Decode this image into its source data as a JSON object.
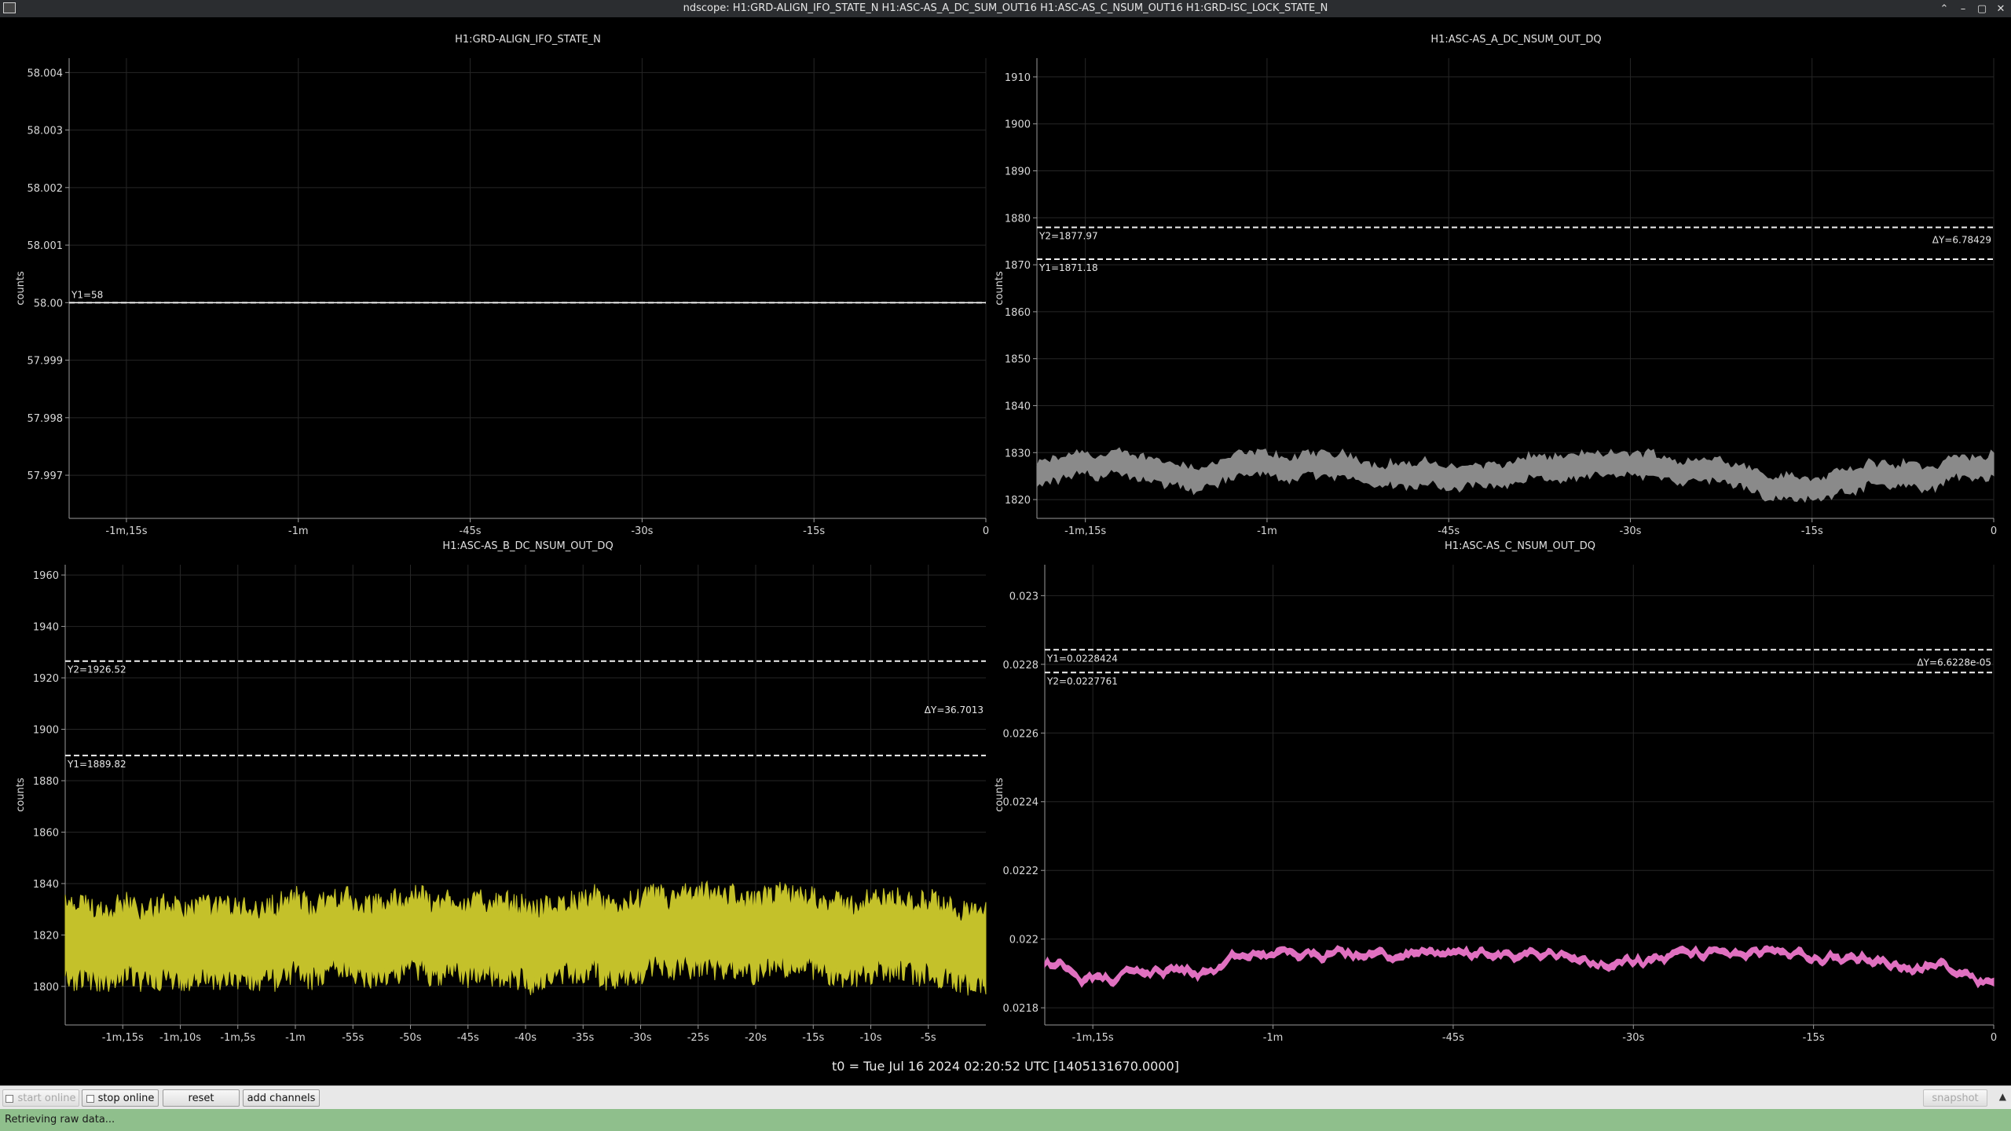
{
  "window": {
    "title": "ndscope: H1:GRD-ALIGN_IFO_STATE_N H1:ASC-AS_A_DC_SUM_OUT16 H1:ASC-AS_C_NSUM_OUT16 H1:GRD-ISC_LOCK_STATE_N",
    "buttons": [
      "⌃",
      "–",
      "▢",
      "✕"
    ]
  },
  "plots": [
    {
      "title": "H1:GRD-ALIGN_IFO_STATE_N",
      "ylabel": "counts",
      "yticks": [
        "58.004",
        "58.003",
        "58.002",
        "58.001",
        "58.00",
        "57.999",
        "57.998",
        "57.997"
      ],
      "ytick_values": [
        58.004,
        58.003,
        58.002,
        58.001,
        58.0,
        57.999,
        57.998,
        57.997
      ],
      "ylim": [
        57.99625,
        58.00425
      ],
      "xticks": [
        "-1m,15s",
        "-1m",
        "-45s",
        "-30s",
        "-15s",
        "0"
      ],
      "xtick_values": [
        -75,
        -60,
        -45,
        -30,
        -15,
        0
      ],
      "xlim": [
        -80,
        0
      ],
      "trace_color": "#ffffff",
      "trace_style": "flat",
      "trace_center": 58.0,
      "cursors": [
        {
          "label": "Y1=58",
          "value": 58.0
        }
      ],
      "delta": ""
    },
    {
      "title": "H1:ASC-AS_A_DC_NSUM_OUT_DQ",
      "ylabel": "counts",
      "yticks": [
        "1910",
        "1900",
        "1890",
        "1880",
        "1870",
        "1860",
        "1850",
        "1840",
        "1830",
        "1820"
      ],
      "ytick_values": [
        1910,
        1900,
        1890,
        1880,
        1870,
        1860,
        1850,
        1840,
        1830,
        1820
      ],
      "ylim": [
        1816,
        1914
      ],
      "xticks": [
        "-1m,15s",
        "-1m",
        "-45s",
        "-30s",
        "-15s",
        "0"
      ],
      "xtick_values": [
        -75,
        -60,
        -45,
        -30,
        -15,
        0
      ],
      "xlim": [
        -79,
        0
      ],
      "trace_color": "#8a8a8a",
      "trace_style": "band",
      "trace_center": 1825,
      "trace_halfwidth": 2.5,
      "trace_wander": 3,
      "cursors": [
        {
          "label": "Y2=1877.97",
          "value": 1877.97
        },
        {
          "label": "Y1=1871.18",
          "value": 1871.18
        }
      ],
      "delta": "ΔY=6.78429"
    },
    {
      "title": "H1:ASC-AS_B_DC_NSUM_OUT_DQ",
      "ylabel": "counts",
      "yticks": [
        "1960",
        "1940",
        "1920",
        "1900",
        "1880",
        "1860",
        "1840",
        "1820",
        "1800"
      ],
      "ytick_values": [
        1960,
        1940,
        1920,
        1900,
        1880,
        1860,
        1840,
        1820,
        1800
      ],
      "ylim": [
        1785,
        1964
      ],
      "xticks": [
        "-1m,15s",
        "-1m,10s",
        "-1m,5s",
        "-1m",
        "-55s",
        "-50s",
        "-45s",
        "-40s",
        "-35s",
        "-30s",
        "-25s",
        "-20s",
        "-15s",
        "-10s",
        "-5s"
      ],
      "xtick_values": [
        -75,
        -70,
        -65,
        -60,
        -55,
        -50,
        -45,
        -40,
        -35,
        -30,
        -25,
        -20,
        -15,
        -10,
        -5
      ],
      "xlim": [
        -80,
        0
      ],
      "trace_color": "#c4c12a",
      "trace_style": "noise",
      "trace_center": 1818,
      "trace_halfwidth": 17,
      "trace_wander": 3,
      "cursors": [
        {
          "label": "Y2=1926.52",
          "value": 1926.52
        },
        {
          "label": "Y1=1889.82",
          "value": 1889.82
        }
      ],
      "delta": "ΔY=36.7013"
    },
    {
      "title": "H1:ASC-AS_C_NSUM_OUT_DQ",
      "ylabel": "counts",
      "yticks": [
        "0.023",
        "0.0228",
        "0.0226",
        "0.0224",
        "0.0222",
        "0.022",
        "0.0218"
      ],
      "ytick_values": [
        0.023,
        0.0228,
        0.0226,
        0.0224,
        0.0222,
        0.022,
        0.0218
      ],
      "ylim": [
        0.02175,
        0.02309
      ],
      "xticks": [
        "-1m,15s",
        "-1m",
        "-45s",
        "-30s",
        "-15s",
        "0"
      ],
      "xtick_values": [
        -75,
        -60,
        -45,
        -30,
        -15,
        0
      ],
      "xlim": [
        -79,
        0
      ],
      "trace_color": "#e070c0",
      "trace_style": "line",
      "trace_center": 0.02192,
      "trace_halfwidth": 1e-05,
      "trace_wander": 5e-05,
      "cursors": [
        {
          "label": "Y1=0.0228424",
          "value": 0.0228424
        },
        {
          "label": "Y2=0.0227761",
          "value": 0.0227761
        }
      ],
      "delta": "ΔY=6.6228e-05"
    }
  ],
  "t0_label": "t0 = Tue Jul 16 2024 02:20:52 UTC [1405131670.0000]",
  "controls": {
    "start_online": "start online",
    "stop_online": "stop online",
    "reset": "reset",
    "add_channels": "add channels",
    "snapshot": "snapshot",
    "collapse_arrow": "▲"
  },
  "status": "Retrieving raw data..."
}
